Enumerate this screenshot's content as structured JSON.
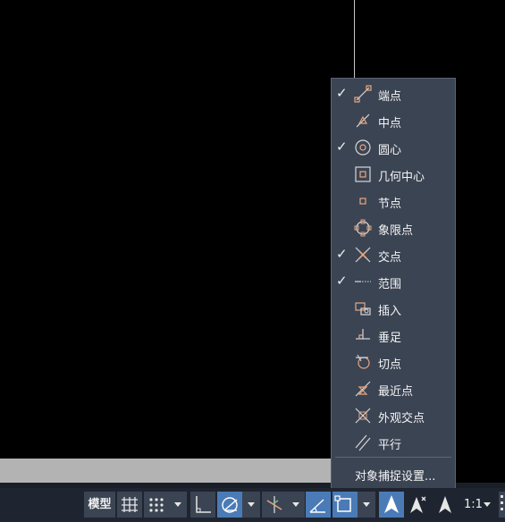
{
  "menu": {
    "items": [
      {
        "label": "端点",
        "checked": true,
        "icon": "endpoint-snap-icon"
      },
      {
        "label": "中点",
        "checked": false,
        "icon": "midpoint-snap-icon"
      },
      {
        "label": "圆心",
        "checked": true,
        "icon": "center-snap-icon"
      },
      {
        "label": "几何中心",
        "checked": false,
        "icon": "geometric-center-snap-icon"
      },
      {
        "label": "节点",
        "checked": false,
        "icon": "node-snap-icon"
      },
      {
        "label": "象限点",
        "checked": false,
        "icon": "quadrant-snap-icon"
      },
      {
        "label": "交点",
        "checked": true,
        "icon": "intersection-snap-icon"
      },
      {
        "label": "范围",
        "checked": true,
        "icon": "extension-snap-icon"
      },
      {
        "label": "插入",
        "checked": false,
        "icon": "insertion-snap-icon"
      },
      {
        "label": "垂足",
        "checked": false,
        "icon": "perpendicular-snap-icon"
      },
      {
        "label": "切点",
        "checked": false,
        "icon": "tangent-snap-icon"
      },
      {
        "label": "最近点",
        "checked": false,
        "icon": "nearest-snap-icon"
      },
      {
        "label": "外观交点",
        "checked": false,
        "icon": "apparent-intersection-snap-icon"
      },
      {
        "label": "平行",
        "checked": false,
        "icon": "parallel-snap-icon"
      }
    ],
    "settings_label": "对象捕捉设置..."
  },
  "statusbar": {
    "model_label": "模型",
    "scale_label": "1:1"
  },
  "colors": {
    "menu_bg": "#3b4453",
    "statusbar_bg": "#1f2530",
    "active_button": "#4a7bb7",
    "snap_icon": "#e8a780"
  }
}
